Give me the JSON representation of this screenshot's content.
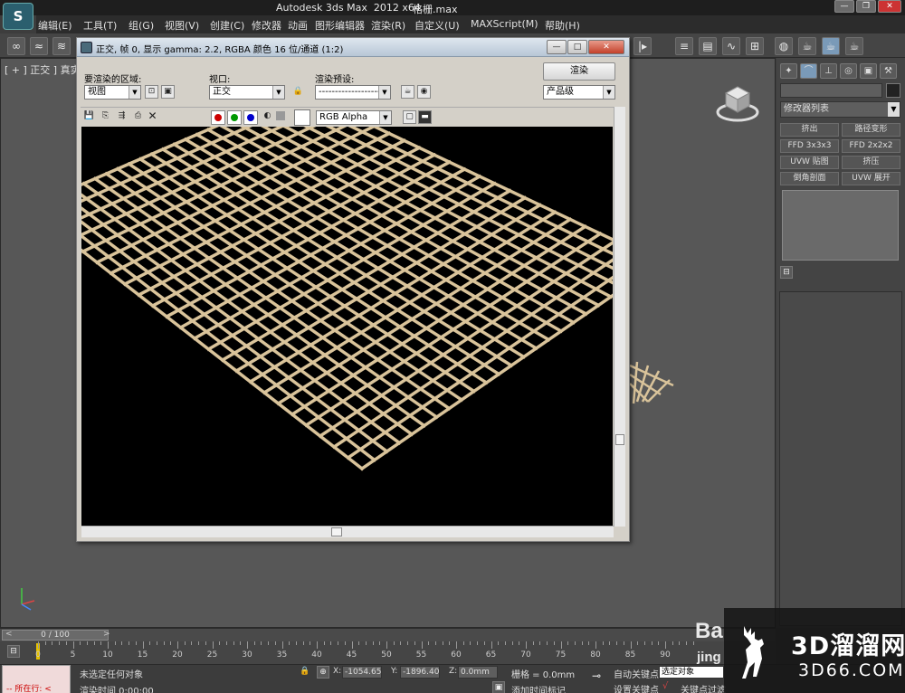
{
  "app": {
    "title": "Autodesk 3ds Max  2012 x64",
    "file": "格栅.max",
    "logo": "S"
  },
  "menu": [
    "编辑(E)",
    "工具(T)",
    "组(G)",
    "视图(V)",
    "创建(C)",
    "修改器",
    "动画",
    "图形编辑器",
    "渲染(R)",
    "自定义(U)",
    "MAXScript(M)",
    "帮助(H)"
  ],
  "viewport": {
    "label": "[ + ] 正交 ] 真实"
  },
  "render_dialog": {
    "title": "正交, 帧 0, 显示 gamma: 2.2, RGBA 颜色 16 位/通道 (1:2)",
    "area_label": "要渲染的区域:",
    "area_value": "视图",
    "viewport_label": "视口:",
    "viewport_value": "正交",
    "preset_label": "渲染预设:",
    "preset_value": "--------------------",
    "render_button": "渲染",
    "quality_value": "产品级",
    "channel_value": "RGB Alpha",
    "colors": {
      "red": "#cc0000",
      "green": "#009900",
      "blue": "#0000cc",
      "grid": "#d9c39a"
    }
  },
  "command_panel": {
    "modifier_list": "修改器列表",
    "modifiers": [
      "挤出",
      "路径变形",
      "FFD 3x3x3",
      "FFD 2x2x2",
      "UVW 贴图",
      "挤压",
      "倒角剖面",
      "UVW 展开"
    ]
  },
  "timeline": {
    "frame_display": "0 / 100",
    "prev": "<",
    "next": ">",
    "ticks": [
      "0",
      "5",
      "10",
      "15",
      "20",
      "25",
      "30",
      "35",
      "40",
      "45",
      "50",
      "55",
      "60",
      "65",
      "70",
      "75",
      "80",
      "85",
      "90"
    ]
  },
  "status": {
    "maxscript_text": "-- 所在行: <",
    "selection": "未选定任何对象",
    "render_time": "渲染时间  0:00:00",
    "x_label": "X:",
    "x_value": "-1054.658",
    "y_label": "Y:",
    "y_value": "-1896.405",
    "z_label": "Z:",
    "z_value": "0.0mm",
    "grid": "栅格 = 0.0mm",
    "add_time_tag": "添加时间标记",
    "auto_key": "自动关键点",
    "set_key": "设置关键点",
    "selected_object": "选定对象",
    "key_filter": "关键点过滤"
  },
  "watermark": {
    "baidu": "Ba",
    "baidu_sub": "jing",
    "brand_big": "3D溜溜网",
    "brand_small": "3D66.COM"
  }
}
